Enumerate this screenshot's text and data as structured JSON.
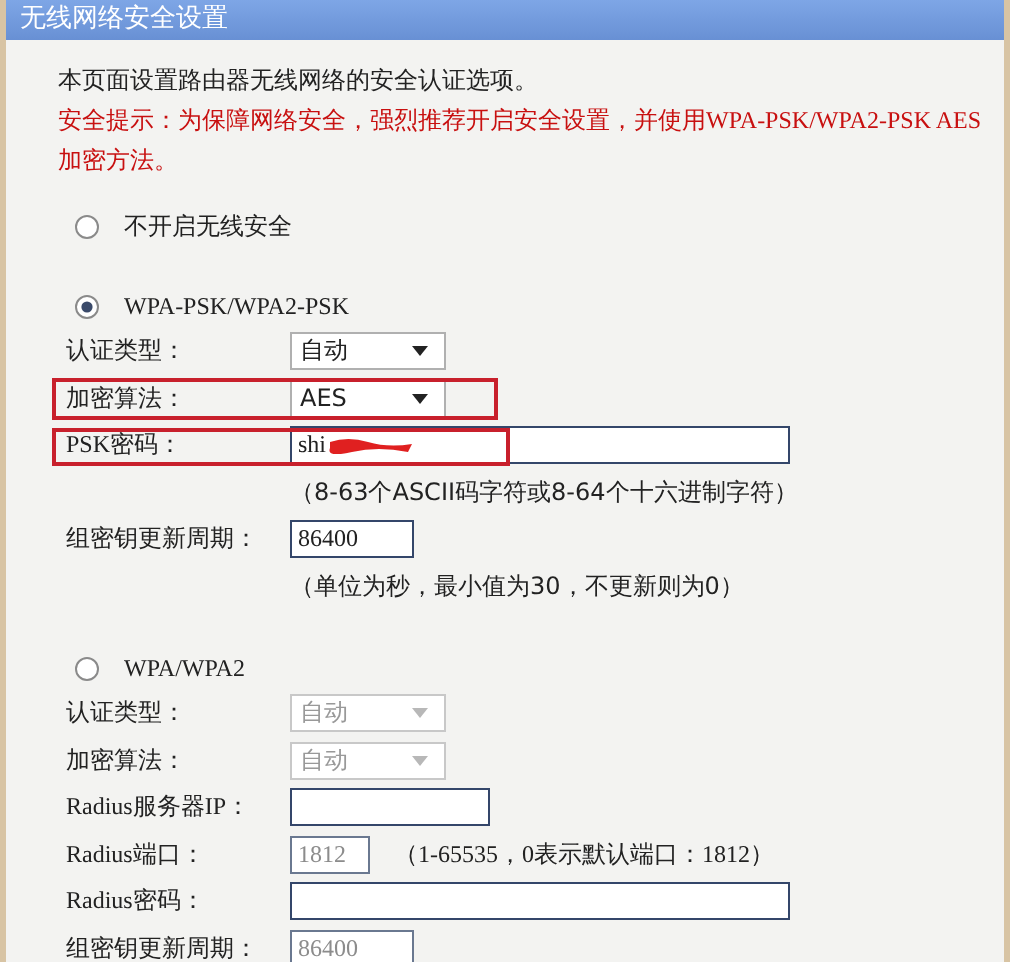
{
  "title": "无线网络安全设置",
  "intro": "本页面设置路由器无线网络的安全认证选项。",
  "warning": "安全提示：为保障网络安全，强烈推荐开启安全设置，并使用WPA-PSK/WPA2-PSK AES加密方法。",
  "options": [
    {
      "label": "不开启无线安全",
      "selected": false
    },
    {
      "label": "WPA-PSK/WPA2-PSK",
      "selected": true,
      "fields": [
        {
          "kind": "select",
          "label": "认证类型：",
          "value": "自动",
          "disabled": false,
          "highlighted": false
        },
        {
          "kind": "select",
          "label": "加密算法：",
          "value": "AES",
          "disabled": false,
          "highlighted": true
        },
        {
          "kind": "password",
          "label": "PSK密码：",
          "value": "shi",
          "redacted": true,
          "disabled": false,
          "highlighted": true
        },
        {
          "kind": "note",
          "text": "（8-63个ASCII码字符或8-64个十六进制字符）"
        },
        {
          "kind": "number",
          "label": "组密钥更新周期：",
          "value": "86400",
          "disabled": false,
          "highlighted": false
        },
        {
          "kind": "note",
          "text": "（单位为秒，最小值为30，不更新则为0）"
        }
      ]
    },
    {
      "label": "WPA/WPA2",
      "selected": false,
      "fields": [
        {
          "kind": "select",
          "label": "认证类型：",
          "value": "自动",
          "disabled": true,
          "highlighted": false
        },
        {
          "kind": "select",
          "label": "加密算法：",
          "value": "自动",
          "disabled": true,
          "highlighted": false
        },
        {
          "kind": "text",
          "label": "Radius服务器IP：",
          "disabled": false,
          "highlighted": false
        },
        {
          "kind": "port",
          "label": "Radius端口：",
          "value": "1812",
          "hint": "（1-65535，0表示默认端口：1812）",
          "disabled": true,
          "highlighted": false
        },
        {
          "kind": "password",
          "label": "Radius密码：",
          "disabled": false,
          "highlighted": false
        },
        {
          "kind": "number",
          "label": "组密钥更新周期：",
          "value": "86400",
          "disabled": true,
          "highlighted": false
        }
      ]
    }
  ]
}
